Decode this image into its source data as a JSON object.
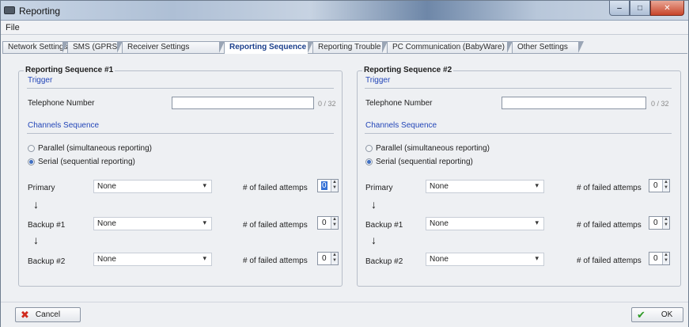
{
  "window": {
    "title": "Reporting"
  },
  "menu": {
    "file": "File"
  },
  "tabs": [
    {
      "label": "Network Settings"
    },
    {
      "label": "SMS (GPRS)"
    },
    {
      "label": "Receiver Settings"
    },
    {
      "label": "Reporting Sequence"
    },
    {
      "label": "Reporting Trouble"
    },
    {
      "label": "PC Communication (BabyWare)"
    },
    {
      "label": "Other Settings"
    }
  ],
  "active_tab": "Reporting Sequence",
  "sequences": [
    {
      "title": "Reporting Sequence #1",
      "trigger_label": "Trigger",
      "telephone_label": "Telephone Number",
      "telephone_value": "",
      "telephone_counter": "0 / 32",
      "channels_label": "Channels Sequence",
      "parallel_label": "Parallel (simultaneous reporting)",
      "serial_label": "Serial (sequential reporting)",
      "selected_mode": "serial",
      "rows": [
        {
          "label": "Primary",
          "channel": "None",
          "failed_label": "# of failed attemps",
          "failed_value": "0"
        },
        {
          "label": "Backup #1",
          "channel": "None",
          "failed_label": "# of failed attemps",
          "failed_value": "0"
        },
        {
          "label": "Backup #2",
          "channel": "None",
          "failed_label": "# of failed attemps",
          "failed_value": "0"
        }
      ]
    },
    {
      "title": "Reporting Sequence #2",
      "trigger_label": "Trigger",
      "telephone_label": "Telephone Number",
      "telephone_value": "",
      "telephone_counter": "0 / 32",
      "channels_label": "Channels Sequence",
      "parallel_label": "Parallel (simultaneous reporting)",
      "serial_label": "Serial (sequential reporting)",
      "selected_mode": "serial",
      "rows": [
        {
          "label": "Primary",
          "channel": "None",
          "failed_label": "# of failed attemps",
          "failed_value": "0"
        },
        {
          "label": "Backup #1",
          "channel": "None",
          "failed_label": "# of failed attemps",
          "failed_value": "0"
        },
        {
          "label": "Backup #2",
          "channel": "None",
          "failed_label": "# of failed attemps",
          "failed_value": "0"
        }
      ]
    }
  ],
  "buttons": {
    "cancel": "Cancel",
    "ok": "OK"
  },
  "colors": {
    "link_blue": "#2346b8",
    "active_tab_text": "#1b3f8c",
    "cancel_red": "#d02a1e",
    "ok_green": "#2e9a26"
  },
  "icons": {
    "app": "app-icon",
    "minimize": "minimize-icon",
    "maximize": "maximize-icon",
    "close": "close-icon",
    "dropdown": "chevron-down-icon",
    "flow_arrow": "arrow-down-icon",
    "cancel": "x-icon",
    "ok": "check-icon"
  }
}
